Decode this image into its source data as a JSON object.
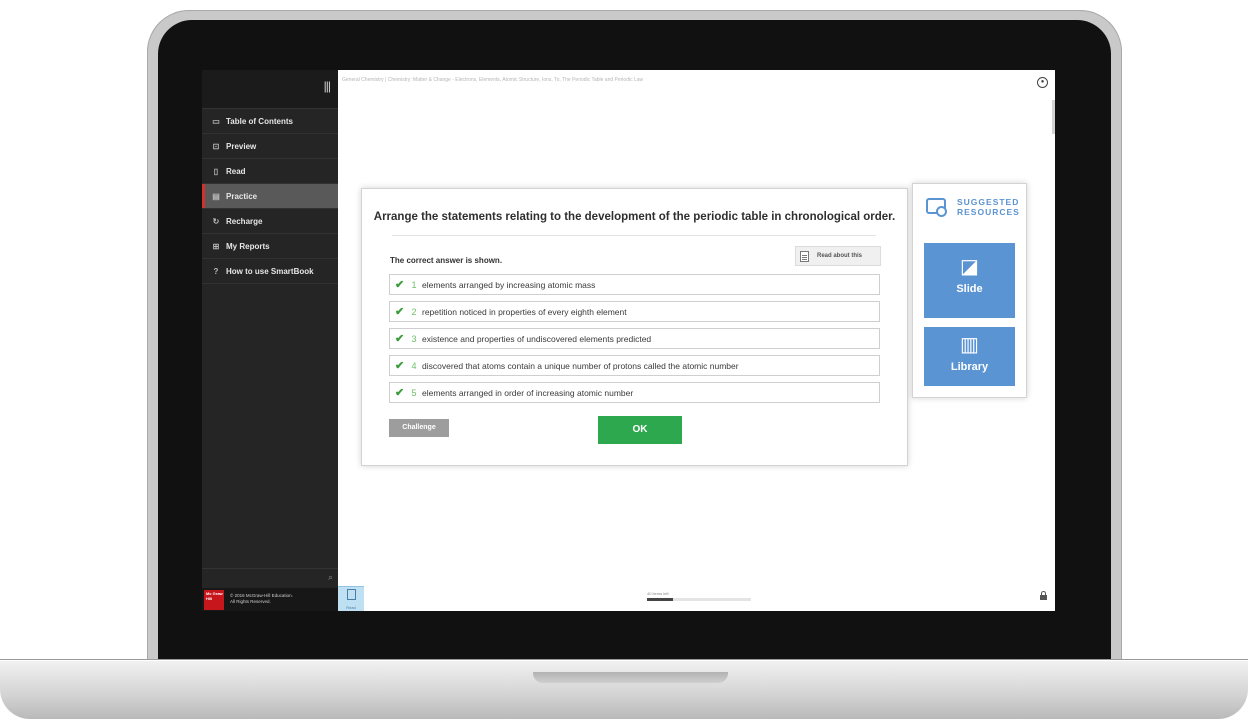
{
  "sidebar": {
    "items": [
      {
        "label": "Table of Contents",
        "icon": "folder-icon"
      },
      {
        "label": "Preview",
        "icon": "magnifier-doc-icon"
      },
      {
        "label": "Read",
        "icon": "document-icon"
      },
      {
        "label": "Practice",
        "icon": "practice-icon",
        "active": true
      },
      {
        "label": "Recharge",
        "icon": "recharge-icon"
      },
      {
        "label": "My Reports",
        "icon": "report-icon"
      },
      {
        "label": "How to use SmartBook",
        "icon": "help-icon"
      }
    ],
    "footer": {
      "logo_text": "Mc Graw Hill",
      "copyright_line1": "© 2016 McGraw-Hill Education.",
      "copyright_line2": "All Rights Reserved."
    }
  },
  "breadcrumb": "General Chemistry | Chemistry: Matter & Change - Electrons, Elements, Atomic Structure, Ions, To, The Periodic Table and Periodic Law",
  "question": {
    "title": "Arrange the statements relating to the development of the periodic table in chronological order.",
    "status": "The correct answer is shown.",
    "read_about": "Read about this",
    "answers": [
      {
        "num": "1",
        "text": "elements arranged by increasing atomic mass"
      },
      {
        "num": "2",
        "text": "repetition noticed in properties of every eighth element"
      },
      {
        "num": "3",
        "text": "existence and properties of undiscovered elements predicted"
      },
      {
        "num": "4",
        "text": "discovered that atoms contain a unique number of protons called the atomic number"
      },
      {
        "num": "5",
        "text": "elements arranged in order of increasing atomic number"
      }
    ],
    "challenge_label": "Challenge",
    "ok_label": "OK"
  },
  "resources": {
    "title_line1": "SUGGESTED",
    "title_line2": "RESOURCES",
    "slide_label": "Slide",
    "library_label": "Library"
  },
  "bottom": {
    "read_label": "Read",
    "progress_label": "40 items left",
    "progress_fraction": 0.25
  },
  "colors": {
    "accent_blue": "#5b94d2",
    "ok_green": "#2ea84f",
    "check_green": "#3a9d3a",
    "active_marker_red": "#d0312d"
  }
}
